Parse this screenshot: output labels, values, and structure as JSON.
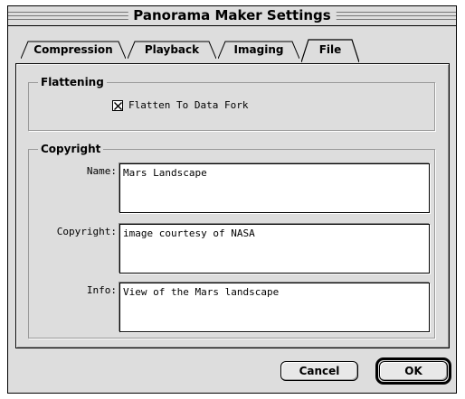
{
  "window": {
    "title": "Panorama Maker Settings"
  },
  "tabs": [
    {
      "label": "Compression"
    },
    {
      "label": "Playback"
    },
    {
      "label": "Imaging"
    },
    {
      "label": "File",
      "selected": true
    }
  ],
  "flattening": {
    "group_label": "Flattening",
    "checkbox_label": "Flatten To Data Fork",
    "checked": true
  },
  "copyright": {
    "group_label": "Copyright",
    "fields": [
      {
        "label": "Name:",
        "value": "Mars Landscape"
      },
      {
        "label": "Copyright:",
        "value": "image courtesy of NASA"
      },
      {
        "label": "Info:",
        "value": "View of the Mars landscape"
      }
    ]
  },
  "buttons": {
    "cancel": "Cancel",
    "ok": "OK"
  }
}
